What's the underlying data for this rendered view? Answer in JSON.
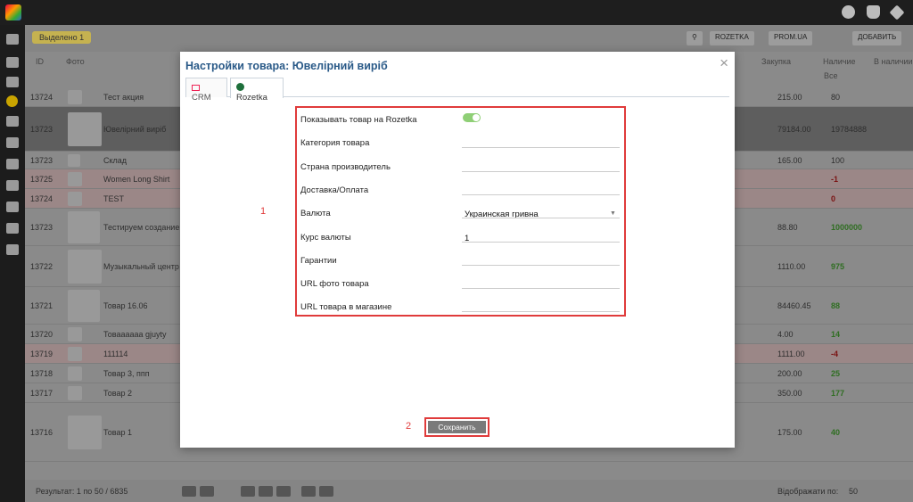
{
  "modal": {
    "title": "Настройки товара: Ювелірний виріб",
    "close_glyph": "×",
    "tabs": [
      {
        "label": "CRM",
        "icon": "mail-icon",
        "active": false
      },
      {
        "label": "Rozetka",
        "icon": "rozetka-icon",
        "active": true
      }
    ],
    "fields": [
      {
        "label": "Показывать товар на Rozetka",
        "type": "toggle",
        "checked": true
      },
      {
        "label": "Категория товара",
        "type": "text",
        "value": ""
      },
      {
        "label": "Страна производитель",
        "type": "text",
        "value": ""
      },
      {
        "label": "Доставка/Оплата",
        "type": "text",
        "value": ""
      },
      {
        "label": "Валюта",
        "type": "select",
        "value": "Украинская гривна"
      },
      {
        "label": "Курс валюты",
        "type": "text",
        "value": "1"
      },
      {
        "label": "Гарантии",
        "type": "text",
        "value": ""
      },
      {
        "label": "URL фото товара",
        "type": "text",
        "value": ""
      },
      {
        "label": "URL товара в магазине",
        "type": "text",
        "value": ""
      }
    ],
    "save_label": "Сохранить",
    "annotation_1": "1",
    "annotation_2": "2",
    "accent_color": "#e03b3b"
  },
  "background": {
    "badge": "Выделено 1",
    "toolbar_buttons": [
      "ROZETKA",
      "PROM.UA",
      "ДОБАВИТЬ"
    ],
    "columns": {
      "id": "ID",
      "photo": "Фото",
      "purchase": "Закупка",
      "stock": "Наличие",
      "stock_filter": "Все",
      "in_stock": "В наличии"
    },
    "rows": [
      {
        "id": "13724",
        "name": "Тест акция",
        "price": "215.00",
        "qty": "80",
        "style": "normal"
      },
      {
        "id": "13723",
        "name": "Ювелірний виріб",
        "price": "79184.00",
        "qty": "19784888",
        "style": "dark"
      },
      {
        "id": "13723",
        "name": "Склад",
        "price": "165.00",
        "qty": "100",
        "style": "normal"
      },
      {
        "id": "13725",
        "name": "Women Long Shirt",
        "price": "",
        "qty": "-1",
        "style": "pink"
      },
      {
        "id": "13724",
        "name": "TEST",
        "price": "",
        "qty": "0",
        "style": "pink"
      },
      {
        "id": "13723",
        "name": "Тестируем создание",
        "price": "88.80",
        "qty": "1000000",
        "style": "normal"
      },
      {
        "id": "13722",
        "name": "Музыкальный центр",
        "price": "1110.00",
        "qty": "975",
        "style": "normal"
      },
      {
        "id": "13721",
        "name": "Товар 16.06",
        "price": "84460.45",
        "qty": "88",
        "style": "normal"
      },
      {
        "id": "13720",
        "name": "Товаааааа gjuyty",
        "price": "4.00",
        "qty": "14",
        "style": "normal"
      },
      {
        "id": "13719",
        "name": "111114",
        "price": "1111.00",
        "qty": "-4",
        "style": "pink"
      },
      {
        "id": "13718",
        "name": "Товар 3, ппп",
        "price": "200.00",
        "qty": "25",
        "style": "normal"
      },
      {
        "id": "13717",
        "name": "Товар 2",
        "price": "350.00",
        "qty": "177",
        "style": "normal"
      },
      {
        "id": "13716",
        "name": "Товар 1",
        "price": "175.00",
        "qty": "40",
        "style": "normal"
      }
    ],
    "footer_result": "Результат: 1 по 50 / 6835",
    "footer_show": "Відображати по:",
    "footer_per_page": "50"
  }
}
